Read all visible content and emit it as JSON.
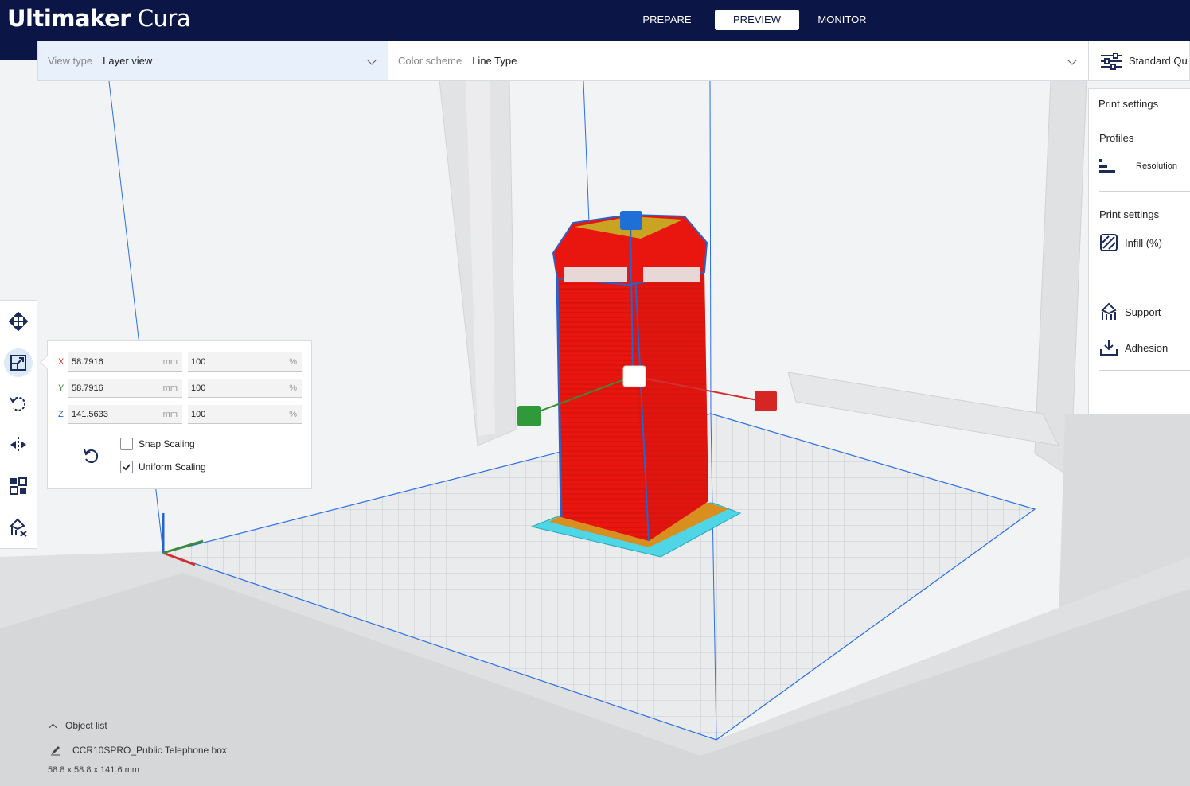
{
  "app": {
    "brand_bold": "Ultimaker",
    "brand_light": "Cura"
  },
  "stages": [
    {
      "label": "PREPARE",
      "active": false
    },
    {
      "label": "PREVIEW",
      "active": true
    },
    {
      "label": "MONITOR",
      "active": false
    }
  ],
  "view_bar": {
    "view_type_label": "View type",
    "view_type_value": "Layer view",
    "color_scheme_label": "Color scheme",
    "color_scheme_value": "Line Type"
  },
  "quality_button": {
    "label": "Standard Qu"
  },
  "print_panel": {
    "title": "Print settings",
    "profiles_heading": "Profiles",
    "resolution_label": "Resolution",
    "settings_heading": "Print settings",
    "infill_label": "Infill (%)",
    "support_label": "Support",
    "adhesion_label": "Adhesion"
  },
  "toolbar": {
    "tools": [
      {
        "name": "move-tool",
        "icon": "move-icon",
        "active": false
      },
      {
        "name": "scale-tool",
        "icon": "scale-icon",
        "active": true
      },
      {
        "name": "rotate-tool",
        "icon": "rotate-icon",
        "active": false
      },
      {
        "name": "mirror-tool",
        "icon": "mirror-icon",
        "active": false
      },
      {
        "name": "per-model-settings-tool",
        "icon": "per-model-settings-icon",
        "active": false
      },
      {
        "name": "support-blocker-tool",
        "icon": "support-blocker-icon",
        "active": false
      }
    ]
  },
  "scale_panel": {
    "axes": [
      {
        "axis": "X",
        "color": "#d32f2f",
        "size": "58.7916",
        "size_unit": "mm",
        "percent": "100",
        "percent_unit": "%"
      },
      {
        "axis": "Y",
        "color": "#3a8a3a",
        "size": "58.7916",
        "size_unit": "mm",
        "percent": "100",
        "percent_unit": "%"
      },
      {
        "axis": "Z",
        "color": "#2a62c9",
        "size": "141.5633",
        "size_unit": "mm",
        "percent": "100",
        "percent_unit": "%"
      }
    ],
    "snap_scaling_label": "Snap Scaling",
    "snap_scaling_checked": false,
    "uniform_scaling_label": "Uniform Scaling",
    "uniform_scaling_checked": true
  },
  "object_list": {
    "heading": "Object list",
    "item_name": "CCR10SPRO_Public Telephone box",
    "dimensions": "58.8 x 58.8 x 141.6 mm"
  },
  "colors": {
    "header_bg": "#0b1646",
    "model_red": "#e8160f",
    "skirt_cyan": "#4fd6e6",
    "bed_outline_blue": "#2a6fe8"
  }
}
